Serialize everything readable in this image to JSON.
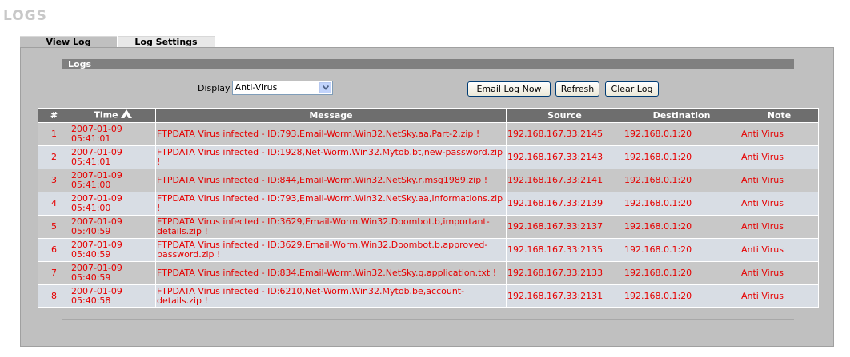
{
  "page": {
    "title": "LOGS"
  },
  "tabs": [
    {
      "label": "View Log",
      "active": true
    },
    {
      "label": "Log Settings",
      "active": false
    }
  ],
  "section": {
    "title": "Logs"
  },
  "display": {
    "label": "Display",
    "selected": "Anti-Virus"
  },
  "buttons": {
    "email": "Email Log Now",
    "refresh": "Refresh",
    "clear": "Clear Log"
  },
  "table": {
    "headers": {
      "num": "#",
      "time": "Time",
      "message": "Message",
      "source": "Source",
      "destination": "Destination",
      "note": "Note"
    },
    "sort_icon": "sort-up-icon",
    "rows": [
      {
        "num": "1",
        "time": "2007-01-09 05:41:01",
        "message": "FTPDATA Virus infected - ID:793,Email-Worm.Win32.NetSky.aa,Part-2.zip !",
        "source": "192.168.167.33:2145",
        "destination": "192.168.0.1:20",
        "note": "Anti Virus"
      },
      {
        "num": "2",
        "time": "2007-01-09 05:41:01",
        "message": "FTPDATA Virus infected - ID:1928,Net-Worm.Win32.Mytob.bt,new-password.zip !",
        "source": "192.168.167.33:2143",
        "destination": "192.168.0.1:20",
        "note": "Anti Virus"
      },
      {
        "num": "3",
        "time": "2007-01-09 05:41:00",
        "message": "FTPDATA Virus infected - ID:844,Email-Worm.Win32.NetSky.r,msg1989.zip !",
        "source": "192.168.167.33:2141",
        "destination": "192.168.0.1:20",
        "note": "Anti Virus"
      },
      {
        "num": "4",
        "time": "2007-01-09 05:41:00",
        "message": "FTPDATA Virus infected - ID:793,Email-Worm.Win32.NetSky.aa,Informations.zip !",
        "source": "192.168.167.33:2139",
        "destination": "192.168.0.1:20",
        "note": "Anti Virus"
      },
      {
        "num": "5",
        "time": "2007-01-09 05:40:59",
        "message": "FTPDATA Virus infected - ID:3629,Email-Worm.Win32.Doombot.b,important-details.zip !",
        "source": "192.168.167.33:2137",
        "destination": "192.168.0.1:20",
        "note": "Anti Virus"
      },
      {
        "num": "6",
        "time": "2007-01-09 05:40:59",
        "message": "FTPDATA Virus infected - ID:3629,Email-Worm.Win32.Doombot.b,approved-password.zip !",
        "source": "192.168.167.33:2135",
        "destination": "192.168.0.1:20",
        "note": "Anti Virus"
      },
      {
        "num": "7",
        "time": "2007-01-09 05:40:59",
        "message": "FTPDATA Virus infected - ID:834,Email-Worm.Win32.NetSky.q,application.txt !",
        "source": "192.168.167.33:2133",
        "destination": "192.168.0.1:20",
        "note": "Anti Virus"
      },
      {
        "num": "8",
        "time": "2007-01-09 05:40:58",
        "message": "FTPDATA Virus infected - ID:6210,Net-Worm.Win32.Mytob.be,account-details.zip !",
        "source": "192.168.167.33:2131",
        "destination": "192.168.0.1:20",
        "note": "Anti Virus"
      }
    ]
  },
  "colors": {
    "log_text": "#e60000",
    "header_bg": "#6e6e6e",
    "panel_bg": "#c0c0c0"
  }
}
